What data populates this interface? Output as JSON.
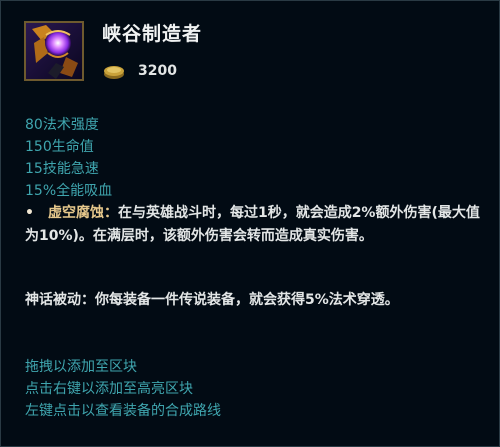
{
  "item": {
    "name": "峡谷制造者",
    "icon": "riftmaker-item-icon",
    "price_icon": "gold-coin-icon",
    "price": "3200"
  },
  "stats": [
    "80法术强度",
    "150生命值",
    "15技能急速",
    "15%全能吸血"
  ],
  "passive": {
    "bullet": "•",
    "name": "虚空腐蚀：",
    "text": "在与英雄战斗时，每过1秒，就会造成2%额外伤害(最大值为10%)。在满层时，该额外伤害会转而造成真实伤害。"
  },
  "mythic": {
    "text": "神话被动：你每装备一件传说装备，就会获得5%法术穿透。"
  },
  "hints": [
    "拖拽以添加至区块",
    "点击右键以添加至高亮区块",
    "左键点击以查看装备的合成路线"
  ],
  "colors": {
    "background": "#010a13",
    "stat_text": "#3fa5ae",
    "body_text": "#e3e6e6",
    "passive_name": "#e6c88c",
    "icon_border": "#6e5a2e"
  }
}
